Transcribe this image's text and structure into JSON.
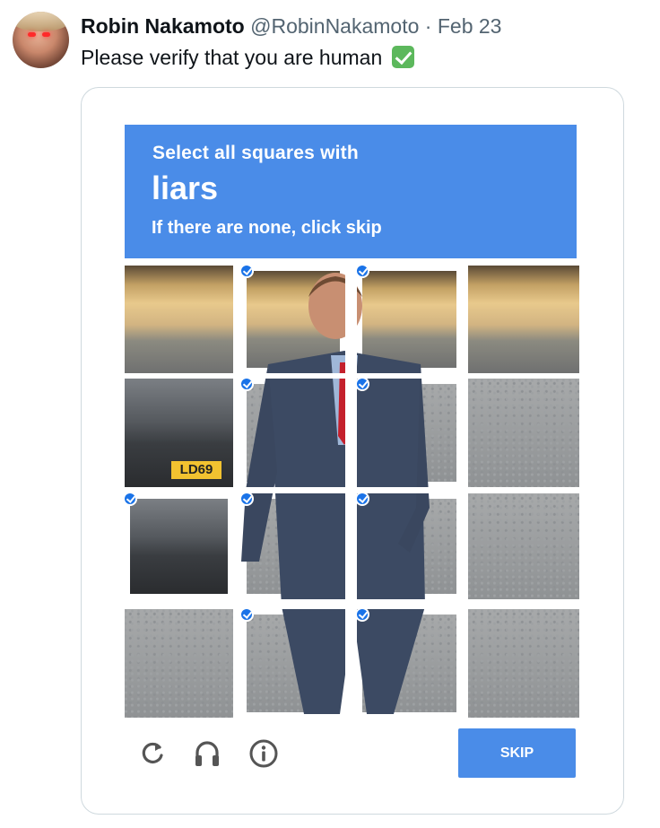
{
  "tweet": {
    "author_name": "Robin Nakamoto",
    "author_handle": "@RobinNakamoto",
    "separator": "·",
    "date": "Feb 23",
    "text": "Please verify that you are human"
  },
  "captcha": {
    "instruction_line1": "Select all squares with",
    "target_word": "liars",
    "instruction_line3": "If there are none, click skip",
    "skip_label": "SKIP",
    "grid": {
      "rows": 4,
      "cols": 4,
      "selected": [
        [
          false,
          true,
          true,
          false
        ],
        [
          false,
          true,
          true,
          false
        ],
        [
          true,
          true,
          true,
          false
        ],
        [
          false,
          true,
          true,
          false
        ]
      ]
    },
    "plate_text": "LD69",
    "controls": [
      "reload-icon",
      "audio-icon",
      "info-icon"
    ]
  },
  "colors": {
    "banner": "#4a8ce8",
    "check": "#1a73e8",
    "handle": "#536471"
  }
}
